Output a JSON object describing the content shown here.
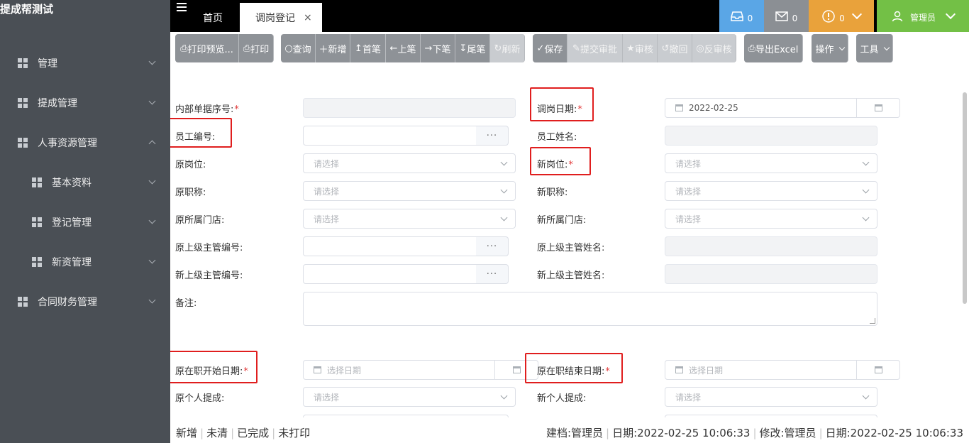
{
  "app": {
    "title": "提成帮测试"
  },
  "sidebar": {
    "items": [
      {
        "label": "管理",
        "expanded": false
      },
      {
        "label": "提成管理",
        "expanded": false
      },
      {
        "label": "人事资源管理",
        "expanded": true
      },
      {
        "label": "基本资料",
        "expanded": false
      },
      {
        "label": "登记管理",
        "expanded": false
      },
      {
        "label": "新资管理",
        "expanded": false
      },
      {
        "label": "合同财务管理",
        "expanded": false
      }
    ]
  },
  "tabs": {
    "home": "首页",
    "active": "调岗登记",
    "close": "×"
  },
  "topbar": {
    "inbox_count": "0",
    "mail_count": "0",
    "alert_count": "0",
    "user": "管理员",
    "colors": {
      "inbox": "#5aa6e6",
      "mail": "#8b8f94",
      "alert": "#e9a23b",
      "user": "#73c046"
    }
  },
  "toolbar": {
    "print_preview": "打印预览...",
    "print": "打印",
    "query": "查询",
    "add": "新增",
    "first": "首笔",
    "prev": "上笔",
    "next": "下笔",
    "last": "尾笔",
    "refresh": "刷新",
    "save": "保存",
    "submit": "提交审批",
    "audit": "审核",
    "revoke": "撤回",
    "unaudit": "反审核",
    "export": "导出Excel",
    "ops": "操作",
    "tools": "工具"
  },
  "form": {
    "internal_no_label": "内部单据序号:",
    "transfer_date_label": "调岗日期:",
    "transfer_date_value": "2022-02-25",
    "emp_no_label": "员工编号:",
    "emp_name_label": "员工姓名:",
    "old_post_label": "原岗位:",
    "new_post_label": "新岗位:",
    "old_title_label": "原职称:",
    "new_title_label": "新职称:",
    "old_store_label": "原所属门店:",
    "new_store_label": "新所属门店:",
    "old_sup_no_label": "原上级主管编号:",
    "old_sup_name_label": "原上级主管姓名:",
    "new_sup_no_label": "新上级主管编号:",
    "new_sup_name_label": "新上级主管姓名:",
    "remark_label": "备注:",
    "old_start_label": "原在职开始日期:",
    "old_end_label": "原在职结束日期:",
    "old_commission_label": "原个人提成:",
    "new_commission_label": "新个人提成:",
    "required_mark": "*",
    "select_placeholder": "请选择",
    "date_placeholder": "选择日期",
    "dots": "···"
  },
  "status": {
    "state1": "新增",
    "state2": "未清",
    "state3": "已完成",
    "state4": "未打印",
    "created": "建档:管理员",
    "created_date": "日期:2022-02-25 10:06:33",
    "modified": "修改:管理员",
    "modified_date": "日期:2022-02-25 10:06:33"
  }
}
